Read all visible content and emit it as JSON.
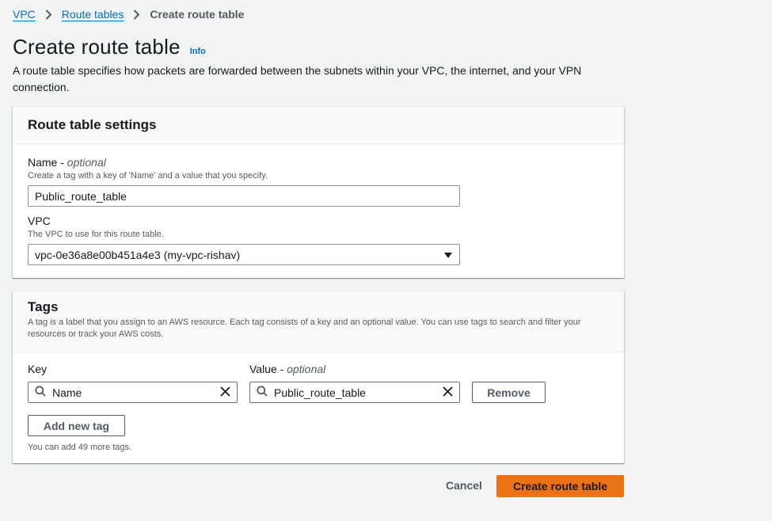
{
  "breadcrumb": {
    "items": [
      "VPC",
      "Route tables"
    ],
    "current": "Create route table"
  },
  "header": {
    "title": "Create route table",
    "info": "Info",
    "description": "A route table specifies how packets are forwarded between the subnets within your VPC, the internet, and your VPN connection."
  },
  "settings": {
    "title": "Route table settings",
    "name_label": "Name - ",
    "name_optional": "optional",
    "name_hint": "Create a tag with a key of 'Name' and a value that you specify.",
    "name_value": "Public_route_table",
    "vpc_label": "VPC",
    "vpc_hint": "The VPC to use for this route table.",
    "vpc_value": "vpc-0e36a8e00b451a4e3 (my-vpc-rishav)"
  },
  "tags": {
    "title": "Tags",
    "description": "A tag is a label that you assign to an AWS resource. Each tag consists of a key and an optional value. You can use tags to search and filter your resources or track your AWS costs.",
    "key_label": "Key",
    "value_label": "Value - ",
    "value_optional": "optional",
    "key_value": "Name",
    "value_value": "Public_route_table",
    "remove_label": "Remove",
    "add_label": "Add new tag",
    "limit_text": "You can add 49 more tags."
  },
  "footer": {
    "cancel_label": "Cancel",
    "create_label": "Create route table"
  },
  "colors": {
    "link": "#0073bb",
    "primary": "#ec7211",
    "background": "#f2f3f3"
  }
}
